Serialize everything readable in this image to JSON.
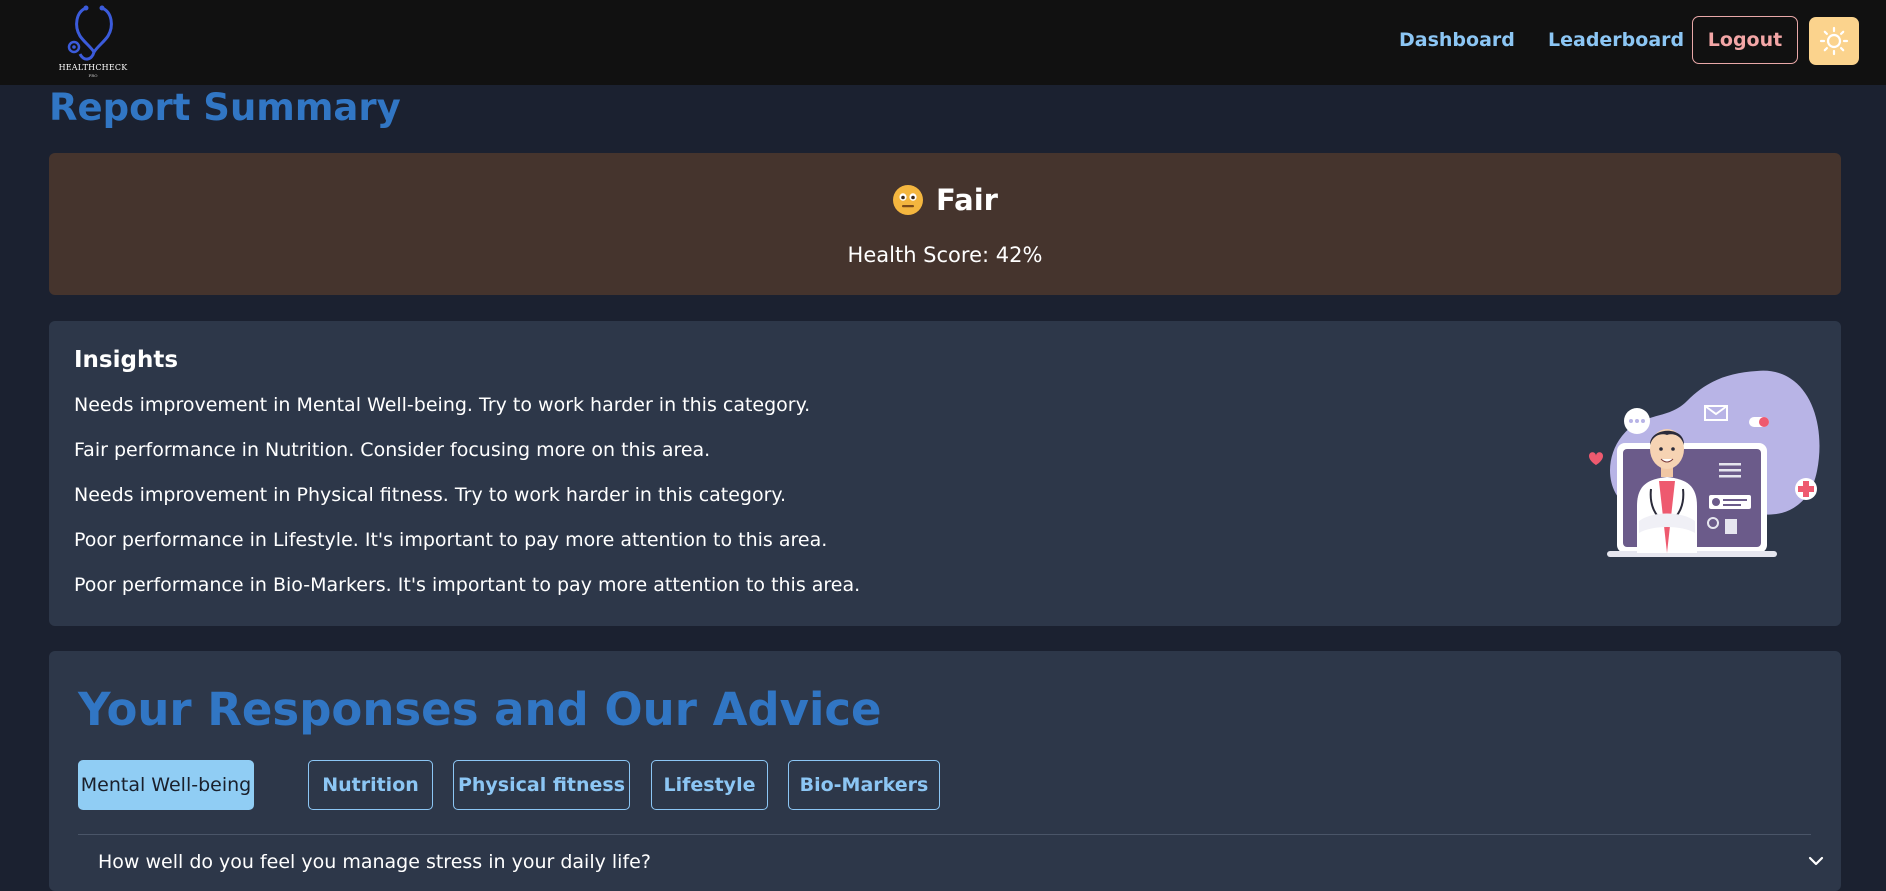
{
  "header": {
    "logo_text": "HEALTHCHECK",
    "logo_subtext": "PRO",
    "nav": [
      {
        "label": "Dashboard"
      },
      {
        "label": "Leaderboard"
      }
    ],
    "logout_label": "Logout",
    "theme_toggle_icon": "sun-icon"
  },
  "page_title": "Report Summary",
  "summary": {
    "status_icon": "neutral-face-emoji",
    "status_emoji": "😐",
    "status_label": "Fair",
    "score_text": "Health Score: 42%",
    "score_percent": 42
  },
  "insights": {
    "title": "Insights",
    "items": [
      "Needs improvement in Mental Well-being. Try to work harder in this category.",
      "Fair performance in Nutrition. Consider focusing more on this area.",
      "Needs improvement in Physical fitness. Try to work harder in this category.",
      "Poor performance in Lifestyle. It's important to pay more attention to this area.",
      "Poor performance in Bio-Markers. It's important to pay more attention to this area."
    ],
    "illustration": "doctor-illustration"
  },
  "advice": {
    "title": "Your Responses and Our Advice",
    "tabs": [
      {
        "label": "Mental Well-being",
        "active": true
      },
      {
        "label": "Nutrition",
        "active": false
      },
      {
        "label": "Physical fitness",
        "active": false
      },
      {
        "label": "Lifestyle",
        "active": false
      },
      {
        "label": "Bio-Markers",
        "active": false
      }
    ],
    "questions": [
      {
        "text": "How well do you feel you manage stress in your daily life?"
      }
    ]
  },
  "colors": {
    "background": "#1b2130",
    "header": "#111111",
    "accent_blue": "#3176c4",
    "link_blue": "#8cc6f4",
    "summary_card": "#45342d",
    "card": "#2d3749",
    "logout": "#f3a6a6",
    "theme_button": "#fbd38d"
  }
}
